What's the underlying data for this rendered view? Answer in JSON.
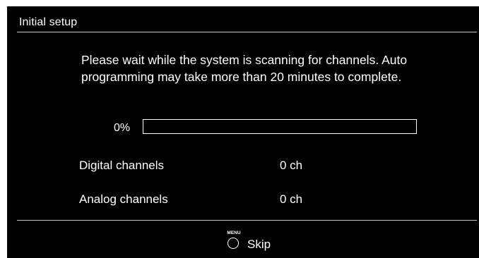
{
  "header": {
    "title": "Initial setup"
  },
  "message": {
    "text": "Please wait while the system is scanning for channels. Auto programming may take more than 20 minutes to complete."
  },
  "progress": {
    "label": "0%",
    "value": 0
  },
  "channels": {
    "digital": {
      "label": "Digital channels",
      "value": "0 ch"
    },
    "analog": {
      "label": "Analog channels",
      "value": "0 ch"
    }
  },
  "footer": {
    "menu_key_label": "MENU",
    "menu_icon": "circle-button-icon",
    "skip_label": "Skip"
  },
  "colors": {
    "background": "#000000",
    "text": "#ffffff",
    "divider": "#c9c9c9"
  }
}
